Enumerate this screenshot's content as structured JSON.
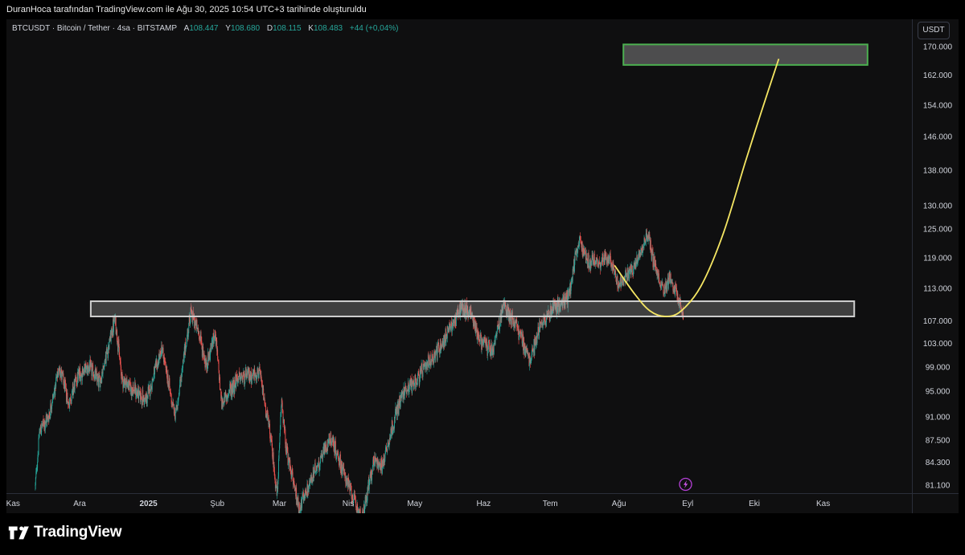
{
  "header": {
    "text": "DuranHoca tarafından TradingView.com ile Ağu 30, 2025 10:54 UTC+3 tarihinde oluşturuldu"
  },
  "symbol_line": {
    "name": "BTCUSDT · Bitcoin / Tether · 4sa · BITSTAMP",
    "open_label": "A",
    "open_value": "108.447",
    "high_label": "Y",
    "high_value": "108.680",
    "low_label": "D",
    "low_value": "108.115",
    "close_label": "K",
    "close_value": "108.483",
    "change": "+44 (+0,04%)"
  },
  "currency_button": "USDT",
  "brand": {
    "name": "TradingView"
  },
  "colors": {
    "background": "#0f0f10",
    "up_candle": "#26a69a",
    "down_candle": "#ef5350",
    "support_zone_border": "#d0d0d0",
    "target_zone_border": "#4caf50",
    "projection_curve": "#f5e663",
    "axis_text": "#d1d4dc"
  },
  "chart_data": {
    "type": "candlestick",
    "title": "BTCUSDT · Bitcoin / Tether · 4sa · BITSTAMP",
    "y_scale": "log",
    "ylim": [
      80000,
      178000
    ],
    "y_ticks": [
      170000,
      162000,
      154000,
      146000,
      138000,
      130000,
      125000,
      119000,
      113000,
      107000,
      103000,
      99000,
      95000,
      91000,
      87500,
      84300,
      81100
    ],
    "y_tick_labels": [
      "170.000",
      "162.000",
      "154.000",
      "146.000",
      "138.000",
      "130.000",
      "125.000",
      "119.000",
      "113.000",
      "107.000",
      "103.000",
      "99.000",
      "95.000",
      "91.000",
      "87.500",
      "84.300",
      "81.100"
    ],
    "x_tick_labels": [
      "Kas",
      "Ara",
      "2025",
      "Şub",
      "Mar",
      "Nis",
      "May",
      "Haz",
      "Tem",
      "Ağu",
      "Eyl",
      "Eki",
      "Kas"
    ],
    "x_tick_dates": [
      "2024-11-01",
      "2024-12-01",
      "2025-01-01",
      "2025-02-01",
      "2025-03-01",
      "2025-04-01",
      "2025-05-01",
      "2025-06-01",
      "2025-07-01",
      "2025-08-01",
      "2025-09-01",
      "2025-10-01",
      "2025-11-01"
    ],
    "x_range": [
      "2024-10-29",
      "2025-12-11"
    ],
    "price_path": [
      [
        "2024-11-11",
        81000
      ],
      [
        "2024-11-13",
        89000
      ],
      [
        "2024-11-17",
        91000
      ],
      [
        "2024-11-22",
        99000
      ],
      [
        "2024-11-26",
        93000
      ],
      [
        "2024-11-30",
        97500
      ],
      [
        "2024-12-05",
        99000
      ],
      [
        "2024-12-10",
        96500
      ],
      [
        "2024-12-17",
        107500
      ],
      [
        "2024-12-20",
        97000
      ],
      [
        "2024-12-26",
        95000
      ],
      [
        "2024-12-31",
        93500
      ],
      [
        "2025-01-07",
        102000
      ],
      [
        "2025-01-13",
        91000
      ],
      [
        "2025-01-20",
        108500
      ],
      [
        "2025-01-24",
        104500
      ],
      [
        "2025-01-27",
        99000
      ],
      [
        "2025-01-31",
        105000
      ],
      [
        "2025-02-03",
        93000
      ],
      [
        "2025-02-10",
        97000
      ],
      [
        "2025-02-20",
        98000
      ],
      [
        "2025-02-25",
        88000
      ],
      [
        "2025-02-28",
        79500
      ],
      [
        "2025-03-02",
        94000
      ],
      [
        "2025-03-04",
        86000
      ],
      [
        "2025-03-10",
        78000
      ],
      [
        "2025-03-17",
        83000
      ],
      [
        "2025-03-24",
        88000
      ],
      [
        "2025-03-31",
        82000
      ],
      [
        "2025-04-07",
        76500
      ],
      [
        "2025-04-13",
        85000
      ],
      [
        "2025-04-16",
        83500
      ],
      [
        "2025-04-22",
        91000
      ],
      [
        "2025-04-26",
        95000
      ],
      [
        "2025-05-01",
        96500
      ],
      [
        "2025-05-08",
        100000
      ],
      [
        "2025-05-14",
        103500
      ],
      [
        "2025-05-22",
        109500
      ],
      [
        "2025-05-26",
        108500
      ],
      [
        "2025-05-30",
        104000
      ],
      [
        "2025-06-05",
        101500
      ],
      [
        "2025-06-10",
        110000
      ],
      [
        "2025-06-16",
        106000
      ],
      [
        "2025-06-22",
        100000
      ],
      [
        "2025-06-27",
        107000
      ],
      [
        "2025-07-03",
        109500
      ],
      [
        "2025-07-09",
        111000
      ],
      [
        "2025-07-14",
        122500
      ],
      [
        "2025-07-18",
        118500
      ],
      [
        "2025-07-23",
        118000
      ],
      [
        "2025-07-28",
        119000
      ],
      [
        "2025-08-01",
        113500
      ],
      [
        "2025-08-07",
        116500
      ],
      [
        "2025-08-11",
        121000
      ],
      [
        "2025-08-14",
        124000
      ],
      [
        "2025-08-17",
        117500
      ],
      [
        "2025-08-21",
        113000
      ],
      [
        "2025-08-24",
        115000
      ],
      [
        "2025-08-30",
        108483
      ]
    ],
    "support_zone": {
      "price_low": 107800,
      "price_high": 110600,
      "from": "2024-12-06",
      "to": "2025-11-15"
    },
    "target_zone": {
      "price_low": 164800,
      "price_high": 170600,
      "from": "2025-08-03",
      "to": "2025-11-21"
    },
    "projection_curve": [
      [
        "2025-07-30",
        117500
      ],
      [
        "2025-08-08",
        112000
      ],
      [
        "2025-08-15",
        108800
      ],
      [
        "2025-08-22",
        107800
      ],
      [
        "2025-08-29",
        108800
      ],
      [
        "2025-09-07",
        113500
      ],
      [
        "2025-09-17",
        124000
      ],
      [
        "2025-09-27",
        140000
      ],
      [
        "2025-10-04",
        152000
      ],
      [
        "2025-10-12",
        166500
      ]
    ],
    "markers": [
      {
        "date": "2025-08-31",
        "icon": "lightning-icon"
      }
    ]
  }
}
